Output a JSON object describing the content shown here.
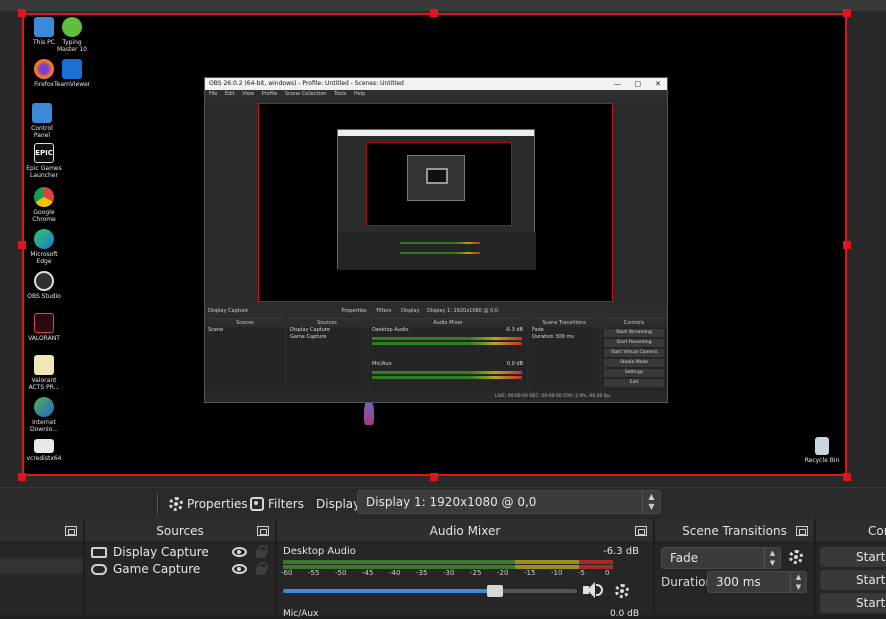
{
  "desktop": {
    "icons": [
      {
        "label": "This PC"
      },
      {
        "label": "Typing Master 10"
      },
      {
        "label": "Firefox"
      },
      {
        "label": "TeamViewer"
      },
      {
        "label": "Control Panel"
      },
      {
        "label": "Epic Games Launcher"
      },
      {
        "label": "Google Chrome"
      },
      {
        "label": "Microsoft Edge"
      },
      {
        "label": "OBS Studio"
      },
      {
        "label": "VALORANT"
      },
      {
        "label": "Valorant ACTS PR..."
      },
      {
        "label": "Internet Downlo..."
      },
      {
        "label": "vcredistx64"
      },
      {
        "label": "Recycle Bin"
      }
    ]
  },
  "nested": {
    "title": "OBS 26.0.2 (64-bit, windows) - Profile: Untitled - Scenes: Untitled",
    "menu": [
      "File",
      "Edit",
      "View",
      "Profile",
      "Scene Collection",
      "Tools",
      "Help"
    ],
    "ctrl": {
      "source": "Display Capture",
      "properties": "Properties",
      "filters": "Filters",
      "display": "Display",
      "display_value": "Display 1: 1920x1080 @ 0,0"
    },
    "docks": {
      "scenes": "Scenes",
      "sources": "Sources",
      "mixer": "Audio Mixer",
      "transitions": "Scene Transitions",
      "controls": "Controls"
    },
    "scene": "Scene",
    "sources": [
      "Display Capture",
      "Game Capture"
    ],
    "mixer": {
      "desktop": "Desktop Audio",
      "desktop_db": "-6.3 dB",
      "mic": "Mic/Aux",
      "mic_db": "0.0 dB"
    },
    "transition": "Fade",
    "duration_label": "Duration",
    "duration": "300 ms",
    "controls": [
      "Start Streaming",
      "Start Recording",
      "Start Virtual Camera",
      "Studio Mode",
      "Settings",
      "Exit"
    ],
    "status": "LIVE: 00:00:00   REC: 00:00:00   CPU: 2.9%, 60.00 fps"
  },
  "toolbar": {
    "properties_label": "Properties",
    "filters_label": "Filters",
    "display_label": "Display",
    "display_value": "Display 1: 1920x1080 @ 0,0",
    "properties_icon": "gear-icon",
    "filters_icon": "filters-icon"
  },
  "docks": {
    "sources": {
      "title": "Sources",
      "items": [
        {
          "label": "Display Capture",
          "icon": "monitor-icon"
        },
        {
          "label": "Game Capture",
          "icon": "gamepad-icon"
        }
      ]
    },
    "mixer": {
      "title": "Audio Mixer",
      "desktop_label": "Desktop Audio",
      "desktop_db": "-6.3 dB",
      "ticks": [
        "-60",
        "-55",
        "-50",
        "-45",
        "-40",
        "-35",
        "-30",
        "-25",
        "-20",
        "-15",
        "-10",
        "-5",
        "0"
      ],
      "volume_fraction": 0.72,
      "next_label": "Mic/Aux",
      "next_db": "0.0 dB"
    },
    "transitions": {
      "title": "Scene Transitions",
      "transition": "Fade",
      "duration_label": "Duration",
      "duration": "300 ms"
    },
    "controls": {
      "title": "Con",
      "buttons": [
        "Start S",
        "Start R",
        "Start Vir"
      ]
    }
  },
  "colors": {
    "selection": "#e0141b",
    "meter_green": "#3c7a2a",
    "meter_yellow": "#9c8f22",
    "meter_red": "#a42b26",
    "slider": "#3f8ad8"
  }
}
